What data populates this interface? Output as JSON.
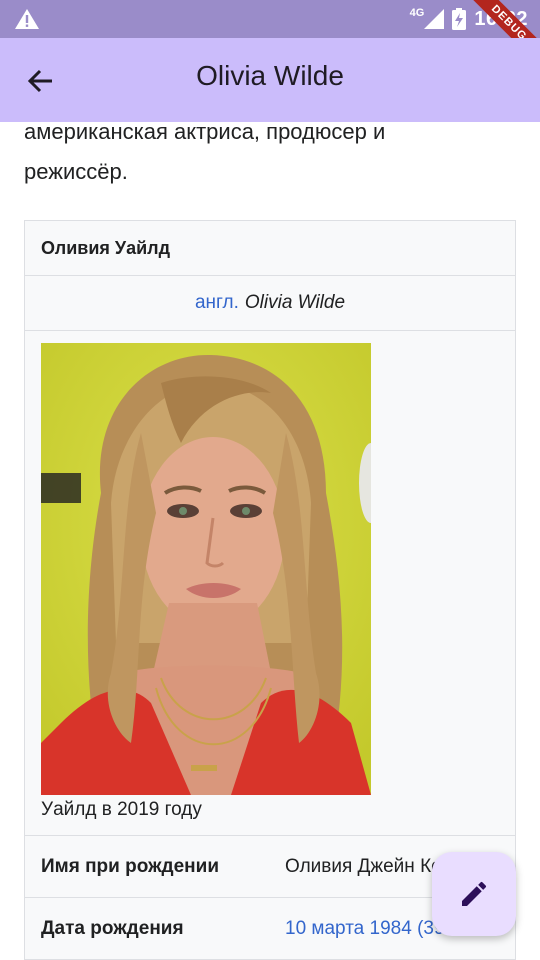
{
  "status_bar": {
    "network": "4G",
    "time": "16:22",
    "debug_label": "DEBUG"
  },
  "app_bar": {
    "title": "Olivia Wilde"
  },
  "intro_text": "американская актриса, продюсер и режиссёр.",
  "infobox": {
    "name": "Оливия Уайлд",
    "original_name": {
      "lang_link": "англ.",
      "name": "Olivia Wilde"
    },
    "photo_caption": "Уайлд в 2019 году",
    "rows": [
      {
        "key": "Имя при рождении",
        "value": "Оливия Джейн Коберн"
      },
      {
        "key": "Дата рождения",
        "value": "10 марта 1984 (39"
      }
    ]
  },
  "icons": {
    "back": "arrow-left-icon",
    "warning": "warning-icon",
    "edit": "pencil-icon"
  },
  "colors": {
    "status_bar": "#9a8cc9",
    "app_bar": "#cbbcfb",
    "fab": "#e9ddff",
    "link": "#3366cc",
    "debug_ribbon": "#b3261e"
  }
}
